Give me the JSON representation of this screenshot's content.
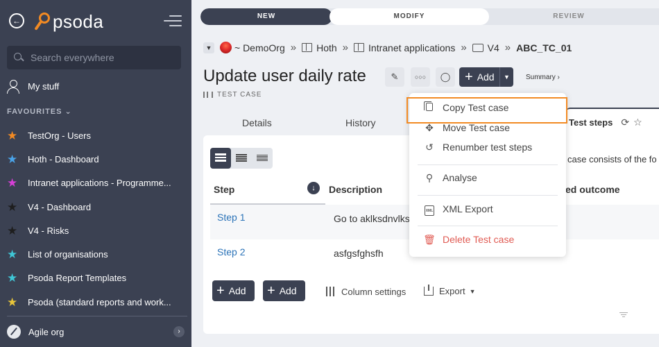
{
  "sidebar": {
    "search_placeholder": "Search everywhere",
    "my_stuff": "My stuff",
    "favourites_heading": "FAVOURITES",
    "favourites": [
      {
        "label": "TestOrg - Users",
        "color": "#f28a23"
      },
      {
        "label": "Hoth - Dashboard",
        "color": "#4aa3e8"
      },
      {
        "label": "Intranet applications - Programme...",
        "color": "#d63fd6"
      },
      {
        "label": "V4 - Dashboard",
        "color": "#222222"
      },
      {
        "label": "V4 - Risks",
        "color": "#222222"
      },
      {
        "label": "List of organisations",
        "color": "#3fc6d6"
      },
      {
        "label": "Psoda Report Templates",
        "color": "#3fc6d6"
      },
      {
        "label": "Psoda (standard reports and work...",
        "color": "#e8c53a"
      }
    ],
    "org_switch": "Agile org",
    "logo_text": "psoda"
  },
  "workflow": {
    "steps": [
      "NEW",
      "MODIFY",
      "REVIEW"
    ]
  },
  "breadcrumb": {
    "org": "~ DemoOrg",
    "items": [
      "Hoth",
      "Intranet applications",
      "V4"
    ],
    "current": "ABC_TC_01"
  },
  "page": {
    "title": "Update user daily rate",
    "type_label": "TEST CASE",
    "add_label": "Add",
    "summary_label": "Summary ›"
  },
  "tabs": [
    "Details",
    "History",
    "Test steps"
  ],
  "table": {
    "intro": "case consists of the fo",
    "columns": [
      "Step",
      "Description",
      "ed outcome"
    ],
    "rows": [
      {
        "step": "Step 1",
        "description": "Go to aklksdnvlks"
      },
      {
        "step": "Step 2",
        "description": "asfgsfghsfh"
      }
    ],
    "add_button_1": "Add",
    "add_button_2": "Add",
    "column_settings": "Column settings",
    "export": "Export"
  },
  "dropdown": {
    "items": [
      {
        "label": "Copy Test case",
        "icon": "copy-icon"
      },
      {
        "label": "Move Test case",
        "icon": "move-icon"
      },
      {
        "label": "Renumber test steps",
        "icon": "renumber-icon"
      },
      {
        "label": "Analyse",
        "icon": "search-icon"
      },
      {
        "label": "XML Export",
        "icon": "xml-icon"
      },
      {
        "label": "Delete Test case",
        "icon": "trash-icon"
      }
    ]
  },
  "colors": {
    "sidebar": "#3b4152",
    "accent": "#f28a23",
    "link": "#2b73b8",
    "danger": "#e05a52"
  }
}
